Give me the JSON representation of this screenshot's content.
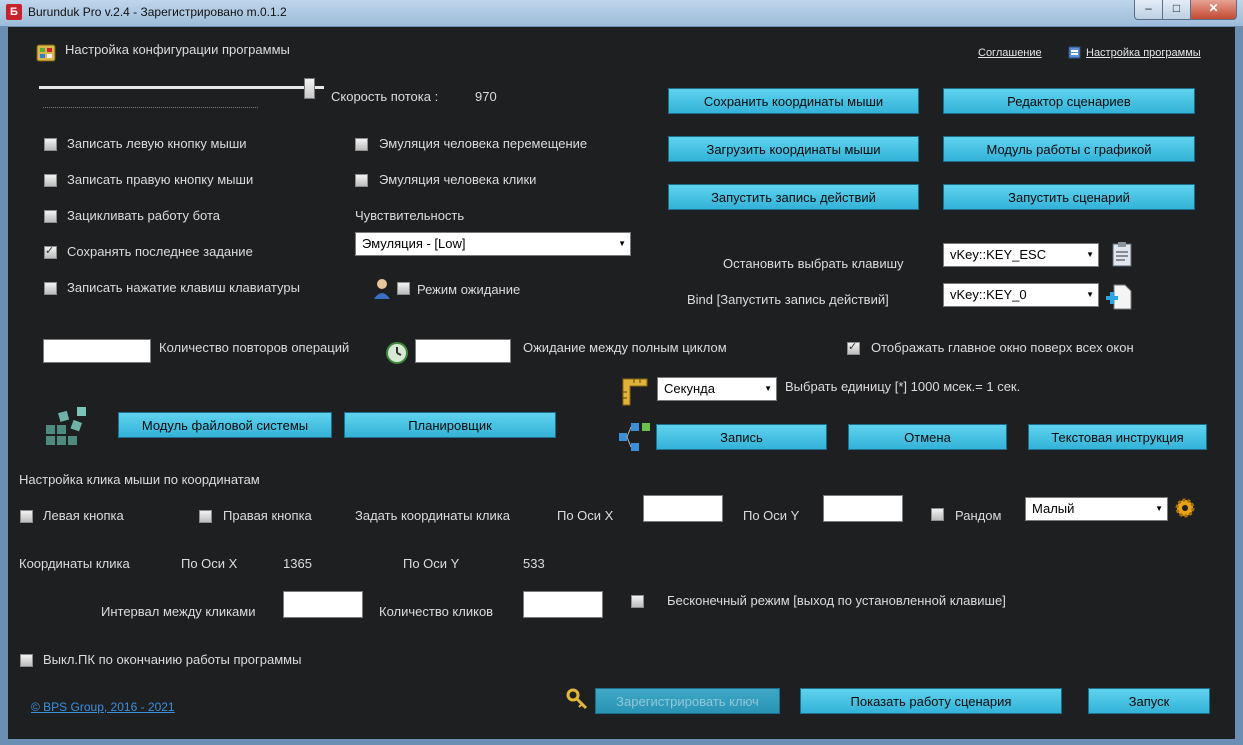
{
  "window": {
    "title": "Burunduk Pro v.2.4 - Зарегистрировано m.0.1.2",
    "app_icon": "Б",
    "minimize": "–",
    "maximize": "□",
    "close": "✕"
  },
  "header": {
    "config_title": "Настройка конфигурации программы",
    "agreement_link": "Соглашение",
    "settings_link": "Настройка программы"
  },
  "stream": {
    "speed_label": "Скорость потока :",
    "speed_value": "970"
  },
  "options": {
    "record_left": "Записать левую кнопку мыши",
    "record_right": "Записать правую кнопку мыши",
    "loop_bot": "Зацикливать работу бота",
    "save_last": "Сохранять последнее задание",
    "record_keys": "Записать нажатие клавиш клавиатуры",
    "emulate_move": "Эмуляция человека перемещение",
    "emulate_click": "Эмуляция человека клики",
    "sensitivity_label": "Чувствительность",
    "sensitivity_value": "Эмуляция - [Low]",
    "wait_mode": "Режим ожидание"
  },
  "actions": {
    "save_coords": "Сохранить координаты мыши",
    "load_coords": "Загрузить координаты мыши",
    "start_record": "Запустить запись действий",
    "scenario_editor": "Редактор сценариев",
    "graphics_module": "Модуль работы с графикой",
    "run_scenario": "Запустить сценарий"
  },
  "keys": {
    "stop_label": "Остановить  выбрать клавишу",
    "stop_value": "vKey::KEY_ESC",
    "bind_label": "Bind [Запустить запись действий]",
    "bind_value": "vKey::KEY_0"
  },
  "repeat": {
    "count_label": "Количество повторов операций",
    "wait_label": "Ожидание между полным циклом",
    "always_on_top": "Отображать главное окно поверх всех окон"
  },
  "units": {
    "unit_value": "Секунда",
    "unit_hint": "Выбрать единицу [*] 1000 мсек.= 1 сек."
  },
  "modules": {
    "filesystem": "Модуль файловой системы",
    "scheduler": "Планировщик"
  },
  "record_row": {
    "record": "Запись",
    "cancel": "Отмена",
    "text_instruction": "Текстовая инструкция"
  },
  "click": {
    "section_title": "Настройка клика мыши по координатам",
    "left_button": "Левая кнопка",
    "right_button": "Правая кнопка",
    "set_coords": "Задать координаты клика",
    "axis_x": "По Оси X",
    "axis_y": "По Оси Y",
    "random": "Рандом",
    "random_value": "Малый",
    "coords_label": "Координаты клика",
    "coord_x": "1365",
    "coord_y": "533",
    "interval_label": "Интервал между кликами",
    "count_label": "Количество кликов",
    "infinite_mode": "Бесконечный режим [выход по установленной клавише]"
  },
  "footer": {
    "shutdown": "Выкл.ПК по окончанию работы программы",
    "copyright": "© BPS Group, 2016 - 2021",
    "register_key": "Зарегистрировать ключ",
    "show_scenario": "Показать работу сценария",
    "launch": "Запуск"
  },
  "colors": {
    "accent": "#4cc6e6",
    "background": "#1e1f21",
    "link": "#3d8fdc"
  }
}
